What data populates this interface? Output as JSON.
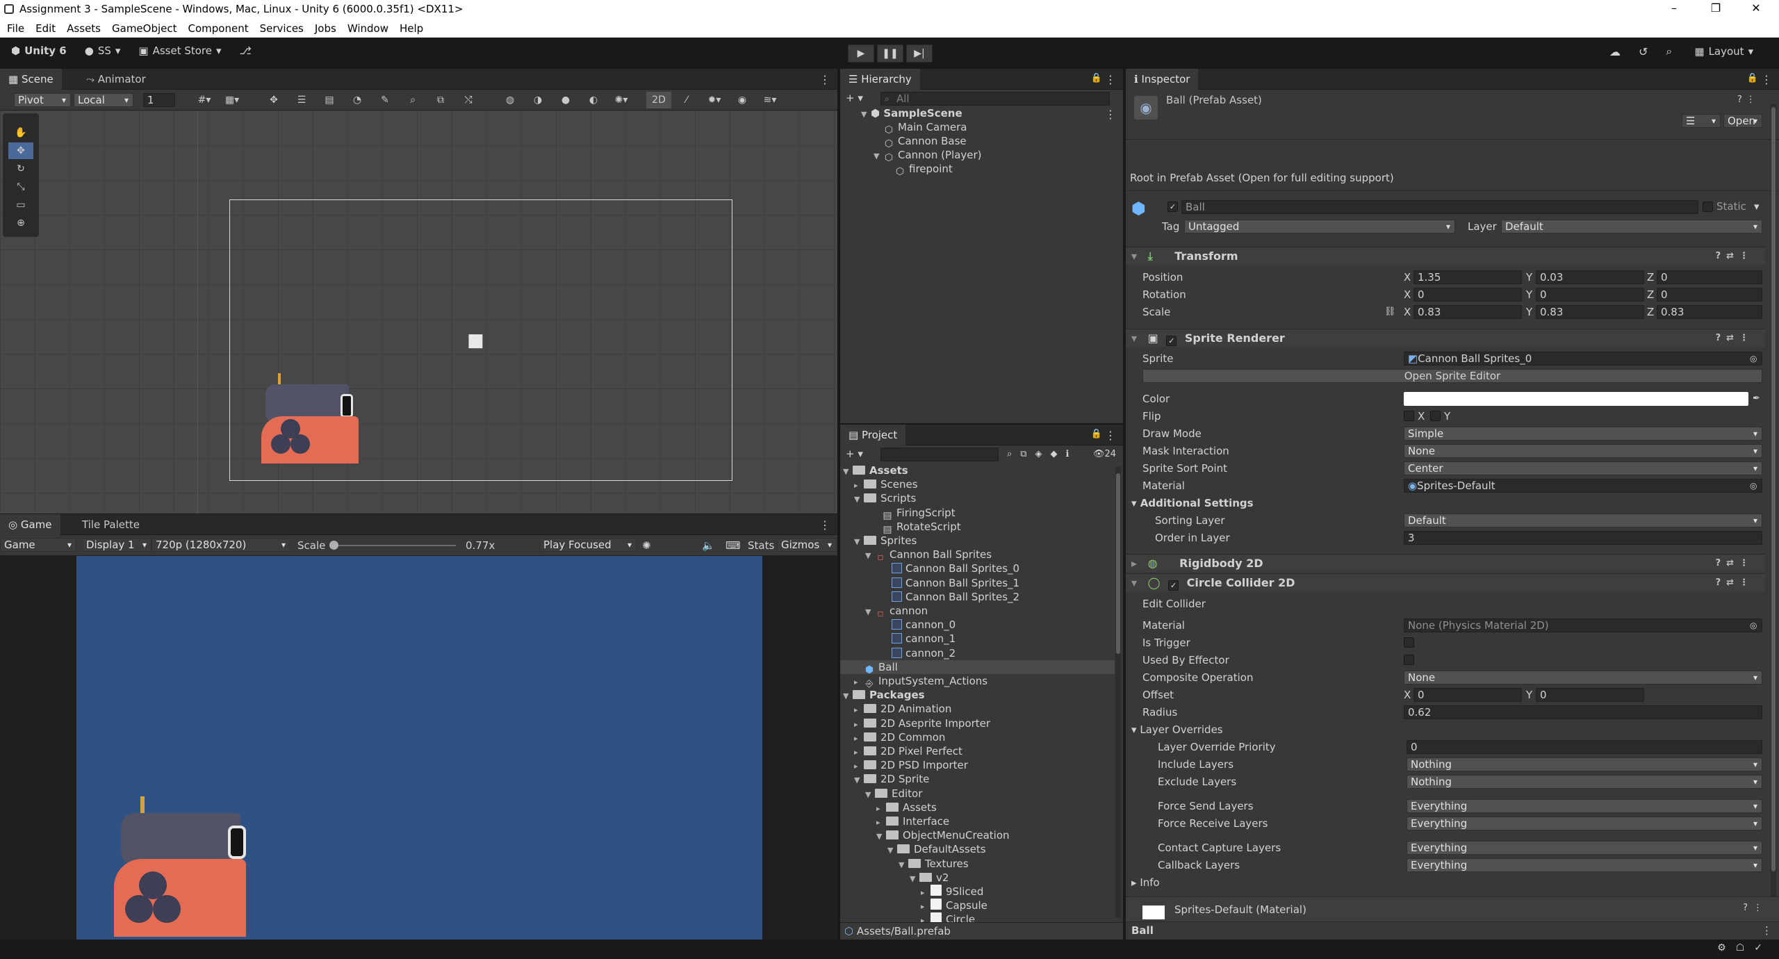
{
  "window": {
    "title": "Assignment 3 - SampleScene - Windows, Mac, Linux - Unity 6 (6000.0.35f1) <DX11>"
  },
  "menu": [
    "File",
    "Edit",
    "Assets",
    "GameObject",
    "Component",
    "Services",
    "Jobs",
    "Window",
    "Help"
  ],
  "toolbar": {
    "account": "Unity 6",
    "user": "SS",
    "asset_store": "Asset Store",
    "layout": "Layout"
  },
  "scene": {
    "tabs": [
      "Scene",
      "Animator"
    ],
    "pivot": "Pivot",
    "local": "Local",
    "grid_snap": "1",
    "mode_2d": "2D"
  },
  "game": {
    "tabs": [
      "Game",
      "Tile Palette"
    ],
    "view": "Game",
    "display": "Display 1",
    "resolution": "720p (1280x720)",
    "scale_label": "Scale",
    "scale_value": "0.77x",
    "play_mode": "Play Focused",
    "stats": "Stats",
    "gizmos": "Gizmos",
    "background_color": "#2d5283"
  },
  "hierarchy": {
    "tab": "Hierarchy",
    "search_placeholder": "All",
    "scene": "SampleScene",
    "items": [
      "Main Camera",
      "Cannon Base",
      "Cannon (Player)",
      "firepoint"
    ]
  },
  "project": {
    "tab": "Project",
    "count": "24",
    "tree": [
      {
        "label": "Assets",
        "bold": true
      },
      {
        "label": "Scenes"
      },
      {
        "label": "Scripts"
      },
      {
        "label": "FiringScript"
      },
      {
        "label": "RotateScript"
      },
      {
        "label": "Sprites"
      },
      {
        "label": "Cannon Ball Sprites"
      },
      {
        "label": "Cannon Ball Sprites_0"
      },
      {
        "label": "Cannon Ball Sprites_1"
      },
      {
        "label": "Cannon Ball Sprites_2"
      },
      {
        "label": "cannon"
      },
      {
        "label": "cannon_0"
      },
      {
        "label": "cannon_1"
      },
      {
        "label": "cannon_2"
      },
      {
        "label": "Ball"
      },
      {
        "label": "InputSystem_Actions"
      },
      {
        "label": "Packages",
        "bold": true
      },
      {
        "label": "2D Animation"
      },
      {
        "label": "2D Aseprite Importer"
      },
      {
        "label": "2D Common"
      },
      {
        "label": "2D Pixel Perfect"
      },
      {
        "label": "2D PSD Importer"
      },
      {
        "label": "2D Sprite"
      },
      {
        "label": "Editor"
      },
      {
        "label": "Assets"
      },
      {
        "label": "Interface"
      },
      {
        "label": "ObjectMenuCreation"
      },
      {
        "label": "DefaultAssets"
      },
      {
        "label": "Textures"
      },
      {
        "label": "v2"
      },
      {
        "label": "9Sliced"
      },
      {
        "label": "Capsule"
      },
      {
        "label": "Circle"
      }
    ],
    "footer_path": "Assets/Ball.prefab"
  },
  "inspector": {
    "tab": "Inspector",
    "asset_title": "Ball (Prefab Asset)",
    "open_button": "Open",
    "root_note": "Root in Prefab Asset (Open for full editing support)",
    "object_name": "Ball",
    "static_label": "Static",
    "tag_label": "Tag",
    "tag_value": "Untagged",
    "layer_label": "Layer",
    "layer_value": "Default",
    "transform": {
      "title": "Transform",
      "position_label": "Position",
      "rotation_label": "Rotation",
      "scale_label": "Scale",
      "pos": {
        "x": "1.35",
        "y": "0.03",
        "z": "0"
      },
      "rot": {
        "x": "0",
        "y": "0",
        "z": "0"
      },
      "scale": {
        "x": "0.83",
        "y": "0.83",
        "z": "0.83"
      }
    },
    "sprite_renderer": {
      "title": "Sprite Renderer",
      "sprite_label": "Sprite",
      "sprite_value": "Cannon Ball Sprites_0",
      "open_editor": "Open Sprite Editor",
      "color_label": "Color",
      "color_value": "#ffffff",
      "flip_label": "Flip",
      "flip_x": "X",
      "flip_y": "Y",
      "draw_mode_label": "Draw Mode",
      "draw_mode": "Simple",
      "mask_label": "Mask Interaction",
      "mask": "None",
      "sort_point_label": "Sprite Sort Point",
      "sort_point": "Center",
      "material_label": "Material",
      "material": "Sprites-Default",
      "additional": "Additional Settings",
      "sorting_layer_label": "Sorting Layer",
      "sorting_layer": "Default",
      "order_label": "Order in Layer",
      "order": "3"
    },
    "rigidbody": {
      "title": "Rigidbody 2D"
    },
    "circle_collider": {
      "title": "Circle Collider 2D",
      "edit_collider": "Edit Collider",
      "material_label": "Material",
      "material": "None (Physics Material 2D)",
      "trigger_label": "Is Trigger",
      "effector_label": "Used By Effector",
      "composite_label": "Composite Operation",
      "composite": "None",
      "offset_label": "Offset",
      "offset_x": "0",
      "offset_y": "0",
      "radius_label": "Radius",
      "radius": "0.62",
      "layer_overrides": "Layer Overrides",
      "priority_label": "Layer Override Priority",
      "priority": "0",
      "include_label": "Include Layers",
      "include": "Nothing",
      "exclude_label": "Exclude Layers",
      "exclude": "Nothing",
      "force_send_label": "Force Send Layers",
      "force_send": "Everything",
      "force_receive_label": "Force Receive Layers",
      "force_receive": "Everything",
      "contact_capture_label": "Contact Capture Layers",
      "contact_capture": "Everything",
      "callback_label": "Callback Layers",
      "callback": "Everything",
      "info": "Info"
    },
    "material_footer": "Sprites-Default (Material)",
    "footer_name": "Ball"
  }
}
